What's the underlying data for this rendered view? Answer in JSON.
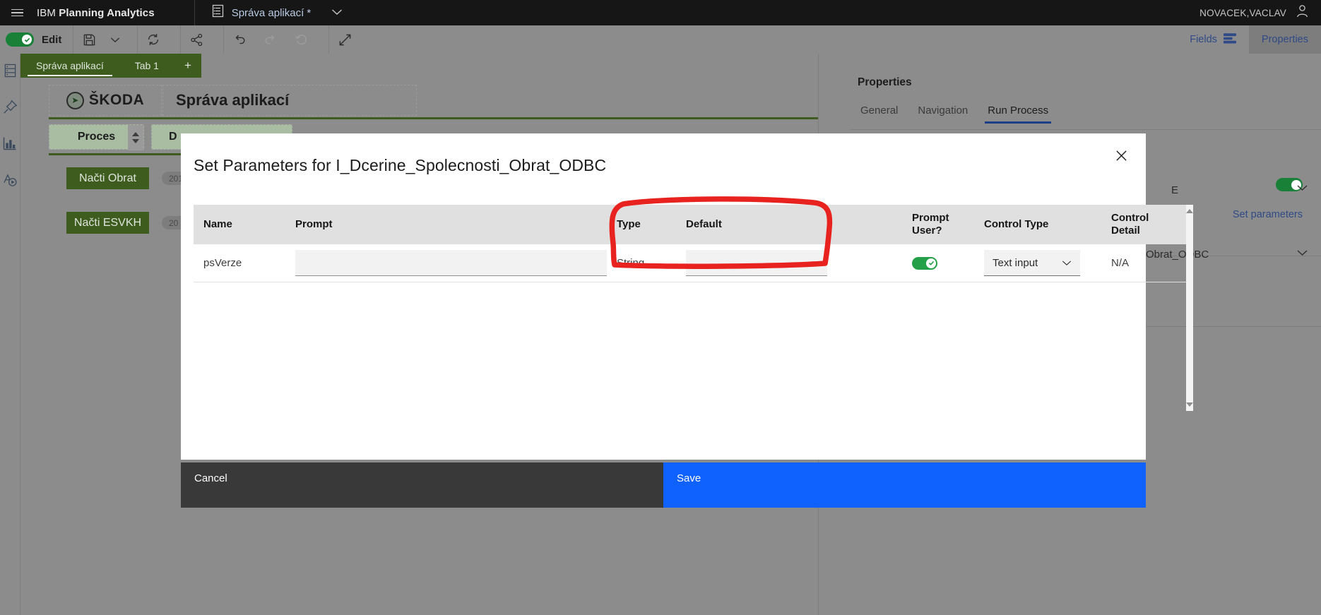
{
  "topbar": {
    "menu_icon": "hamburger-icon",
    "brand_light": "IBM ",
    "brand_bold": "Planning Analytics",
    "document_icon": "sheet-icon",
    "document_title": "Správa aplikací *",
    "document_caret": "chevron-down-icon",
    "user_name": "NOVACEK,VACLAV",
    "user_icon": "user-avatar-icon"
  },
  "toolbar": {
    "edit_toggle_state": "on",
    "edit_label": "Edit",
    "buttons": [
      {
        "name": "save-icon",
        "label": "Save"
      },
      {
        "name": "chevron-down-icon",
        "label": "Save options"
      },
      {
        "name": "refresh-icon",
        "label": "Refresh"
      },
      {
        "name": "share-icon",
        "label": "Share"
      },
      {
        "name": "undo-icon",
        "label": "Undo"
      },
      {
        "name": "redo-icon",
        "label": "Redo"
      },
      {
        "name": "reset-icon",
        "label": "Reset"
      },
      {
        "name": "expand-icon",
        "label": "Fullscreen"
      }
    ],
    "fields_label": "Fields",
    "fields_icon": "fields-icon",
    "properties_label": "Properties"
  },
  "rail": {
    "items": [
      {
        "name": "data-source-icon",
        "label": "Data"
      },
      {
        "name": "pin-icon",
        "label": "Pin"
      },
      {
        "name": "chart-icon",
        "label": "Visualizations"
      },
      {
        "name": "run-process-icon",
        "label": "Actions"
      }
    ]
  },
  "tabs": {
    "items": [
      {
        "label": "Správa aplikací",
        "active": true
      },
      {
        "label": "Tab 1",
        "active": false
      }
    ],
    "add_label": "+"
  },
  "canvas": {
    "logo_text": "ŠKODA",
    "page_title": "Správa aplikací",
    "selector_proces": "Proces",
    "selector_d": "D",
    "buttons": [
      {
        "label": "Načti Obrat",
        "badge": "201"
      },
      {
        "label": "Načti ESVKH",
        "badge": "20"
      }
    ]
  },
  "properties": {
    "title": "Properties",
    "tabs": [
      {
        "label": "General",
        "active": false
      },
      {
        "label": "Navigation",
        "active": false
      },
      {
        "label": "Run Process",
        "active": true
      }
    ],
    "toggle_state": "on",
    "set_parameters_link": "Set parameters",
    "field_value_1": "E",
    "field_value_2": "Obrat_ODBC",
    "caret_icon": "chevron-down-icon"
  },
  "modal": {
    "title": "Set Parameters for I_Dcerine_Spolecnosti_Obrat_ODBC",
    "close_icon": "close-icon",
    "columns": [
      "Name",
      "Prompt",
      "Type",
      "Default",
      "Prompt User?",
      "Control Type",
      "Control Detail"
    ],
    "rows": [
      {
        "name": "psVerze",
        "prompt": "",
        "type": "String",
        "default": "",
        "prompt_user": "on",
        "control_type": "Text input",
        "control_type_caret": "chevron-down-icon",
        "control_detail": "N/A"
      }
    ],
    "scroll_up_icon": "scroll-up-arrow-icon",
    "scroll_down_icon": "scroll-down-arrow-icon",
    "cancel_label": "Cancel",
    "save_label": "Save"
  },
  "annotation": {
    "shape": "red-hand-drawn-rectangle",
    "color": "#e8231f",
    "targets": "Type and Default columns"
  },
  "colors": {
    "topbar_bg": "#161616",
    "app_bg": "#8c8c8c",
    "tab_green": "#3d5c1e",
    "toggle_green": "#198038",
    "save_blue": "#0f62fe",
    "cancel_dark": "#393939",
    "link_blue": "#2f4a86",
    "accent_underline": "#1d3f86"
  }
}
